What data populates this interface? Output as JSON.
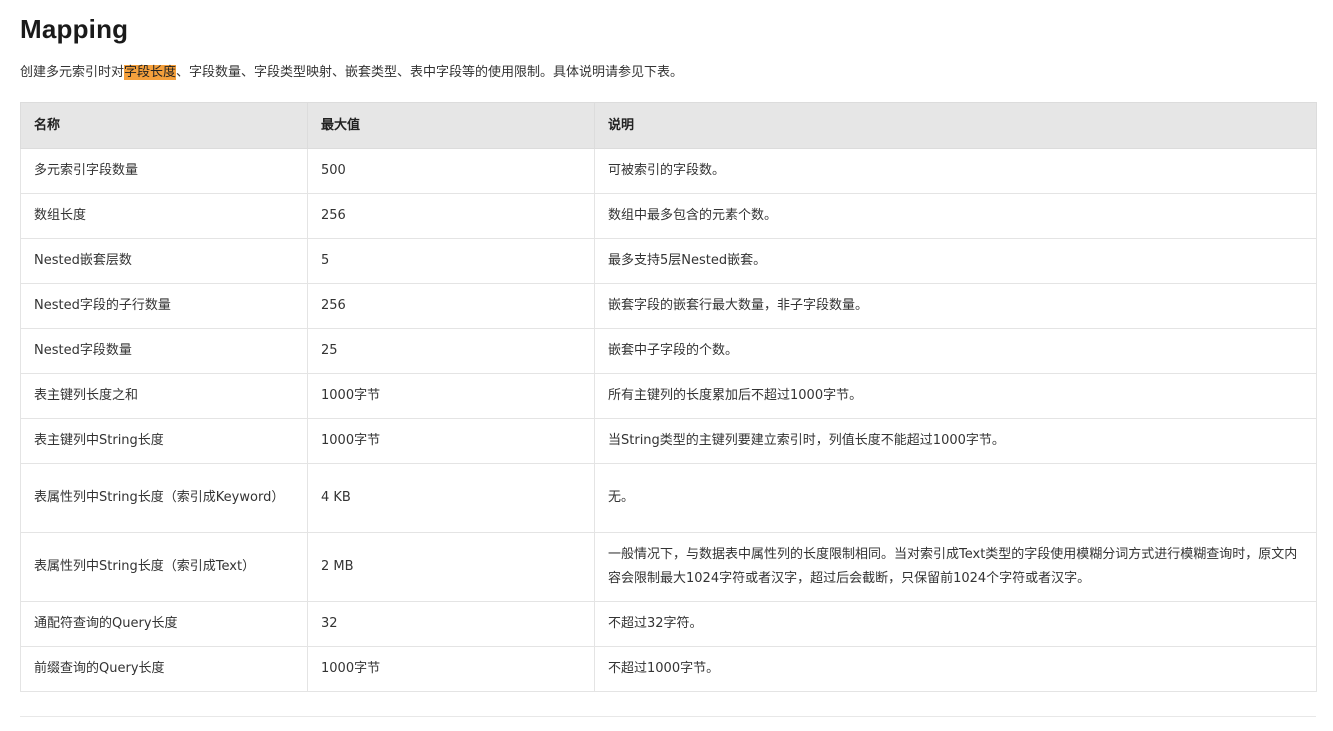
{
  "title": "Mapping",
  "intro": {
    "before": "创建多元索引时对",
    "highlight": "字段长度",
    "after": "、字段数量、字段类型映射、嵌套类型、表中字段等的使用限制。具体说明请参见下表。"
  },
  "table": {
    "headers": [
      "名称",
      "最大值",
      "说明"
    ],
    "rows": [
      [
        "多元索引字段数量",
        "500",
        "可被索引的字段数。"
      ],
      [
        "数组长度",
        "256",
        "数组中最多包含的元素个数。"
      ],
      [
        "Nested嵌套层数",
        "5",
        "最多支持5层Nested嵌套。"
      ],
      [
        "Nested字段的子行数量",
        "256",
        "嵌套字段的嵌套行最大数量，非子字段数量。"
      ],
      [
        "Nested字段数量",
        "25",
        "嵌套中子字段的个数。"
      ],
      [
        "表主键列长度之和",
        "1000字节",
        "所有主键列的长度累加后不超过1000字节。"
      ],
      [
        "表主键列中String长度",
        "1000字节",
        "当String类型的主键列要建立索引时，列值长度不能超过1000字节。"
      ],
      [
        "表属性列中String长度（索引成Keyword）",
        "4 KB",
        "无。"
      ],
      [
        "表属性列中String长度（索引成Text）",
        "2 MB",
        "一般情况下，与数据表中属性列的长度限制相同。当对索引成Text类型的字段使用模糊分词方式进行模糊查询时，原文内容会限制最大1024字符或者汉字，超过后会截断，只保留前1024个字符或者汉字。"
      ],
      [
        "通配符查询的Query长度",
        "32",
        "不超过32字符。"
      ],
      [
        "前缀查询的Query长度",
        "1000字节",
        "不超过1000字节。"
      ]
    ]
  },
  "colors": {
    "highlight": "#f5a03c",
    "header_bg": "#e6e6e6",
    "border": "#e4e4e4",
    "text": "#333333"
  }
}
